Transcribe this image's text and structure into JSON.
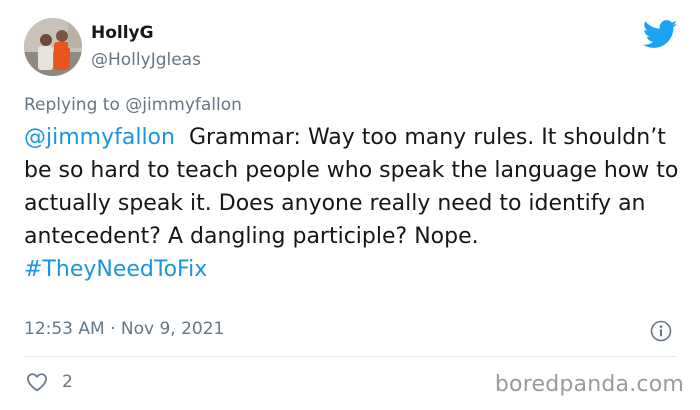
{
  "author": {
    "display_name": "HollyG",
    "handle": "@HollyJgleas"
  },
  "reply": {
    "prefix": "Replying to",
    "mention": "@jimmyfallon"
  },
  "tweet": {
    "mention": "@jimmyfallon",
    "text": "Grammar: Way too many rules. It shouldn’t be so hard to teach people who speak the language how to actually speak it. Does anyone really need to identify an antecedent? A dangling participle? Nope.",
    "hashtag": "#TheyNeedToFix",
    "timestamp": "12:53 AM · Nov 9, 2021"
  },
  "stats": {
    "likes": "2"
  },
  "watermark": "boredpanda.com",
  "icons": {
    "brand": "twitter-bird-icon",
    "info": "info-icon",
    "like": "heart-icon"
  },
  "colors": {
    "twitter_blue": "#1da1f2",
    "link": "#1b95e0",
    "muted": "#657786",
    "text": "#14171a"
  }
}
